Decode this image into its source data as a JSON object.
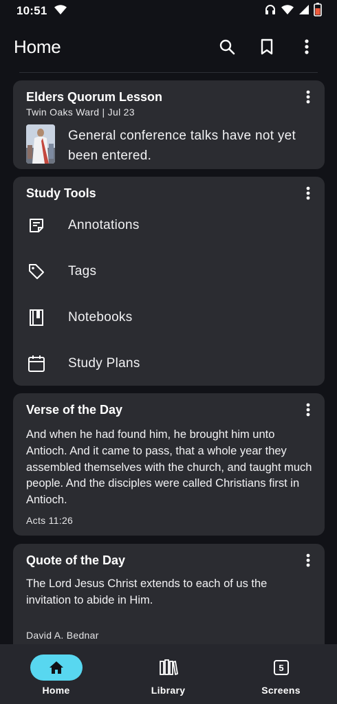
{
  "status_bar": {
    "time": "10:51"
  },
  "app_bar": {
    "title": "Home",
    "icons": [
      "search-icon",
      "bookmark-icon",
      "more-vert-icon"
    ]
  },
  "lesson_card": {
    "title": "Elders Quorum Lesson",
    "subtitle": "Twin Oaks Ward | Jul 23",
    "message": "General conference talks have not yet been entered."
  },
  "study_tools": {
    "title": "Study Tools",
    "items": [
      {
        "label": "Annotations",
        "icon": "annotation-icon"
      },
      {
        "label": "Tags",
        "icon": "tag-icon"
      },
      {
        "label": "Notebooks",
        "icon": "notebook-icon"
      },
      {
        "label": "Study Plans",
        "icon": "calendar-icon"
      }
    ]
  },
  "verse_card": {
    "title": "Verse of the Day",
    "text": "And when he had found him, he brought him unto Antioch. And it came to pass, that a whole year they assembled themselves with the church, and taught much people. And the disciples were called Christians first in Antioch.",
    "reference": "Acts 11:26"
  },
  "quote_card": {
    "title": "Quote of the Day",
    "text": "The Lord Jesus Christ extends to each of us the invitation to abide in Him.",
    "author": "David A. Bednar"
  },
  "bottom_nav": {
    "items": [
      {
        "label": "Home",
        "icon": "home-icon",
        "active": true
      },
      {
        "label": "Library",
        "icon": "library-icon",
        "active": false
      },
      {
        "label": "Screens",
        "icon": "screens-icon",
        "badge": "5",
        "active": false
      }
    ]
  },
  "colors": {
    "background": "#111217",
    "card": "#2b2c31",
    "nav_background": "#26272d",
    "accent": "#58d7f0"
  }
}
